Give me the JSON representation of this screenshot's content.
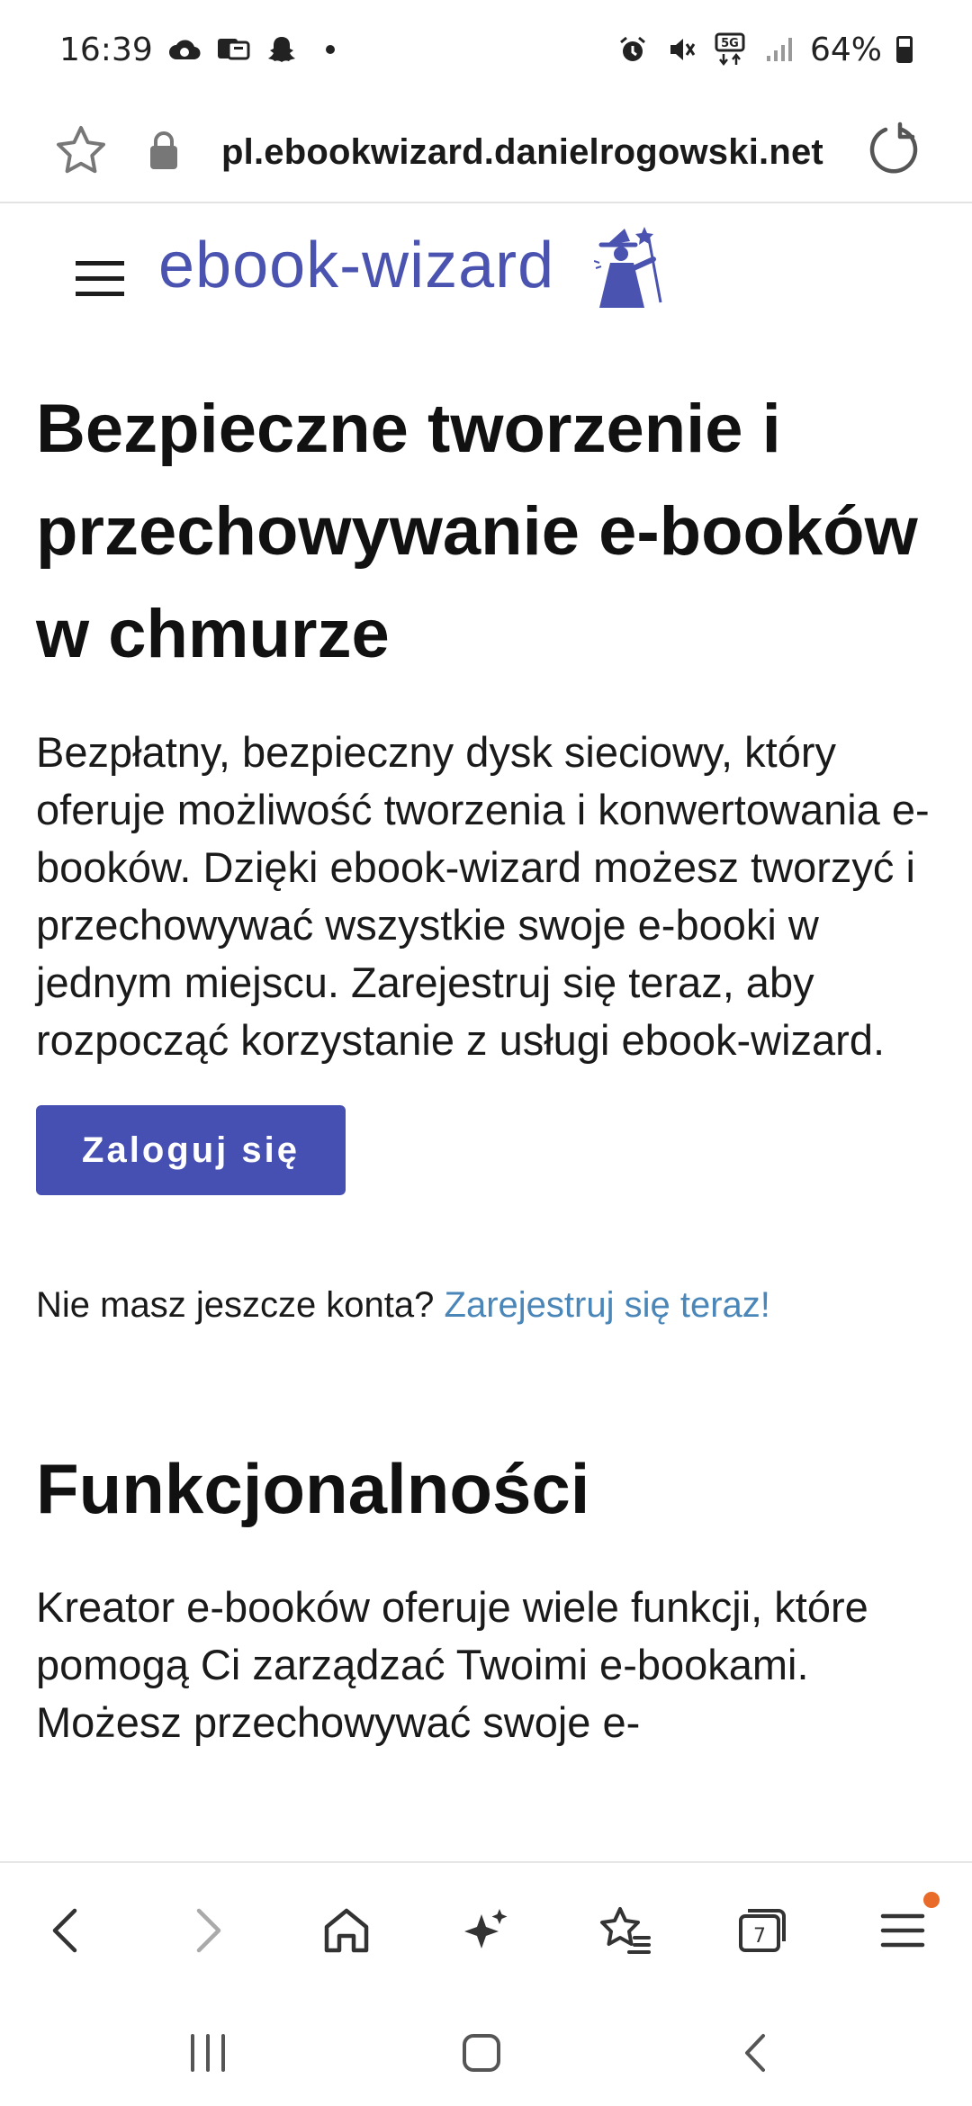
{
  "status_bar": {
    "time": "16:39",
    "left_icons": [
      "cloud-sync-icon",
      "messenger-icon",
      "snapchat-icon",
      "dot-icon"
    ],
    "right_icons": [
      "alarm-icon",
      "mute-icon",
      "5g-icon",
      "signal-icon"
    ],
    "network": "5G",
    "battery": "64%",
    "battery_level": 0.64
  },
  "browser": {
    "url": "pl.ebookwizard.danielrogowski.net",
    "icons": [
      "bookmark-star-icon",
      "lock-icon",
      "reload-icon"
    ]
  },
  "site": {
    "logo_text": "ebook-wizard",
    "logo_icon": "wizard-icon",
    "brand_color": "#4a53b0"
  },
  "hero": {
    "title": "Bezpieczne tworzenie i przechowywanie e-booków w chmurze",
    "description": "Bezpłatny, bezpieczny dysk sieciowy, który oferuje możliwość tworzenia i konwertowania e-booków. Dzięki ebook-wizard możesz tworzyć i przechowywać wszystkie swoje e-booki w jednym miejscu. Zarejestruj się teraz, aby rozpocząć korzystanie z usługi ebook-wizard.",
    "login_button": "Zaloguj się",
    "button_color": "#4650b2",
    "signup_prompt": "Nie masz jeszcze konta?",
    "signup_link": "Zarejestruj się teraz!",
    "link_color": "#4a86b8"
  },
  "features": {
    "title": "Funkcjonalności",
    "description": "Kreator e-booków oferuje wiele funkcji, które pomogą Ci zarządzać Twoimi e-bookami. Możesz przechowywać swoje e-"
  },
  "bottom_nav": {
    "items": [
      "back-icon",
      "forward-icon",
      "home-icon",
      "ai-sparkle-icon",
      "bookmarks-icon",
      "tabs-icon",
      "menu-icon"
    ],
    "tabs_count": "7",
    "notification_color": "#e86b2a"
  },
  "system_nav": {
    "items": [
      "recent-apps-icon",
      "home-button-icon",
      "system-back-icon"
    ]
  }
}
